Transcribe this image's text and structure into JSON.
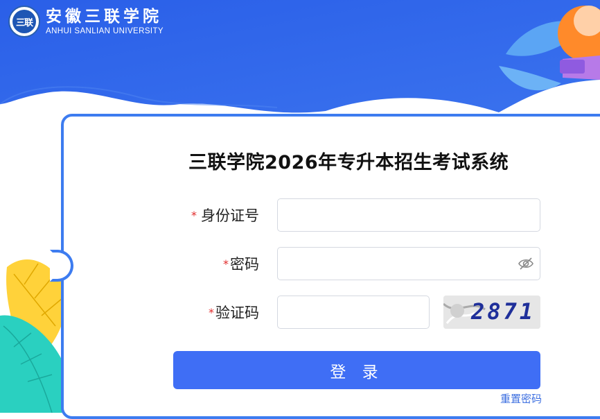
{
  "header": {
    "logo_emblem": "三联",
    "school_name_cn": "安徽三联学院",
    "school_name_en": "ANHUI SANLIAN UNIVERSITY"
  },
  "form": {
    "title": "三联学院2026年专升本招生考试系统",
    "required_mark": "*",
    "id_label": "身份证号",
    "id_value": "",
    "password_label": "密码",
    "password_value": "",
    "captcha_label": "验证码",
    "captcha_value": "",
    "captcha_image_text": "2871",
    "password_toggle_icon": "eye-slash-icon",
    "login_button": "登 录",
    "reset_password_link": "重置密码"
  },
  "colors": {
    "header_blue": "#2f63e6",
    "card_border": "#3d7cf0",
    "button_blue": "#3f6ef5",
    "required_red": "#e12b2b",
    "link_blue": "#3d6fe0"
  }
}
